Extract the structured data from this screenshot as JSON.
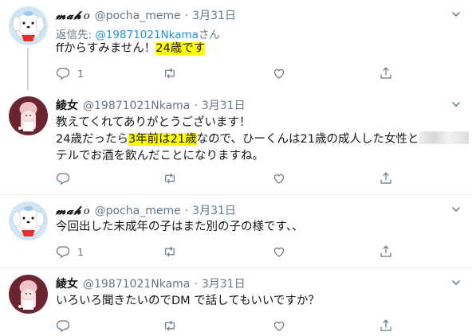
{
  "tweets": [
    {
      "author": {
        "name": "𝓶𝓪𝓱",
        "name_suffix": "o",
        "handle": "@pocha_meme",
        "avatar": "pochacco-avatar"
      },
      "date": "3月31日",
      "reply_to": {
        "prefix": "返信先: ",
        "mention": "@19871021Nkama",
        "suffix": "さん"
      },
      "lines": [
        {
          "parts": [
            {
              "text": "ffからすみません！"
            },
            {
              "text": "24歳です",
              "highlight": true
            }
          ]
        }
      ],
      "reply_count": "1"
    },
    {
      "author": {
        "name": "綾女",
        "handle": "@19871021Nkama",
        "avatar": "doll-avatar"
      },
      "date": "3月31日",
      "lines": [
        {
          "parts": [
            {
              "text": "教えてくれてありがとうございます！"
            }
          ]
        },
        {
          "parts": [
            {
              "text": "24歳だったら"
            },
            {
              "text": "3年前は21歳",
              "highlight": true
            },
            {
              "text": "なので、ひーくんは21歳の成人した女性と"
            }
          ],
          "blurred_tail": true
        },
        {
          "parts": [
            {
              "text": "テルでお酒を飲んだことになりますね。"
            }
          ]
        }
      ],
      "reply_count": ""
    },
    {
      "author": {
        "name": "𝓶𝓪𝓱",
        "name_suffix": "o",
        "handle": "@pocha_meme",
        "avatar": "pochacco-avatar"
      },
      "date": "3月31日",
      "lines": [
        {
          "parts": [
            {
              "text": "今回出した未成年の子はまた別の子の様です、、"
            }
          ]
        }
      ],
      "reply_count": "1"
    },
    {
      "author": {
        "name": "綾女",
        "handle": "@19871021Nkama",
        "avatar": "doll-avatar"
      },
      "date": "3月31日",
      "lines": [
        {
          "parts": [
            {
              "text": "いろいろ聞きたいのでDM で話してもいいですか？"
            }
          ]
        }
      ],
      "reply_count": ""
    }
  ],
  "header_separator": "·",
  "icons": [
    "reply-icon",
    "retweet-icon",
    "like-icon",
    "share-icon",
    "caret-down-icon"
  ],
  "colors": {
    "secondary": "#657786",
    "link": "#1b95e0",
    "highlight": "#ffff00",
    "thread_line": "#ccd6dd"
  }
}
